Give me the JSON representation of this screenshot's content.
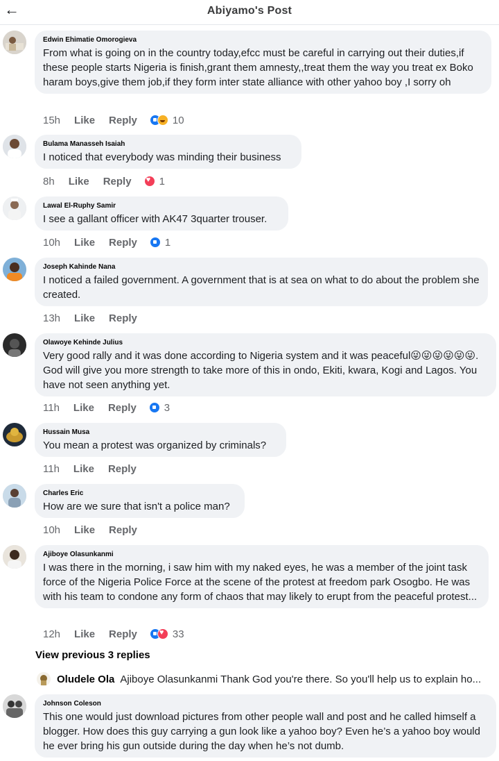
{
  "header": {
    "title": "Abiyamo's Post",
    "back_icon": "arrow-left-icon"
  },
  "action_labels": {
    "like": "Like",
    "reply": "Reply"
  },
  "comments": [
    {
      "author": "Edwin Ehimatie Omorogieva",
      "text": "From what is going on in the country today,efcc must be careful in carrying out their duties,if these people  starts Nigeria is finish,grant them amnesty,,treat them the way you treat ex Boko haram boys,give them job,if they form inter state alliance  with other yahoo boy ,I sorry oh",
      "time": "15h",
      "reactions": [
        "like",
        "haha"
      ],
      "reaction_count": "10"
    },
    {
      "author": "Bulama Manasseh Isaiah",
      "text": "I noticed that everybody was minding their business",
      "time": "8h",
      "reactions": [
        "love"
      ],
      "reaction_count": "1"
    },
    {
      "author": "Lawal El-Ruphy Samir",
      "text": "I see a gallant officer with AK47 3quarter trouser.",
      "time": "10h",
      "reactions": [
        "like"
      ],
      "reaction_count": "1"
    },
    {
      "author": "Joseph Kahinde Nana",
      "text": "I noticed a failed government. A government that is at sea on what to do about the problem she created.",
      "time": "13h",
      "reactions": [],
      "reaction_count": ""
    },
    {
      "author": "Olawoye Kehinde Julius",
      "text": "Very good rally and it was done according to Nigeria system and it was peaceful😜😜😜😜😜😜. God will give you more strength to take more of this in ondo, Ekiti, kwara, Kogi and Lagos. You have not seen anything yet.",
      "time": "11h",
      "reactions": [
        "like"
      ],
      "reaction_count": "3"
    },
    {
      "author": "Hussain Musa",
      "text": "You mean a protest was organized by criminals?",
      "time": "11h",
      "reactions": [],
      "reaction_count": ""
    },
    {
      "author": "Charles Eric",
      "text": "How are we sure that isn't a police man?",
      "time": "10h",
      "reactions": [],
      "reaction_count": ""
    },
    {
      "author": "Ajiboye Olasunkanmi",
      "text": "I was there in the morning, i saw him with my naked eyes, he was a member of the joint task force of the Nigeria Police Force at the scene of the protest at freedom park Osogbo. He was with his team to condone any form of chaos that may likely to erupt from the peaceful protest...",
      "time": "12h",
      "reactions": [
        "like",
        "love"
      ],
      "reaction_count": "33"
    },
    {
      "author": "Johnson Coleson",
      "text": "This one would just download pictures from other people wall and post and he called himself a blogger. How does this guy carrying a gun look like a yahoo boy? Even he’s a yahoo boy would he ever bring his gun outside during the day when he’s not dumb.",
      "time": "",
      "reactions": [],
      "reaction_count": ""
    }
  ],
  "view_previous": "View previous 3 replies",
  "reply_preview": {
    "author": "Oludele Ola",
    "text": "Ajiboye Olasunkanmi Thank God you're there. So you'll help us to explain ho..."
  }
}
